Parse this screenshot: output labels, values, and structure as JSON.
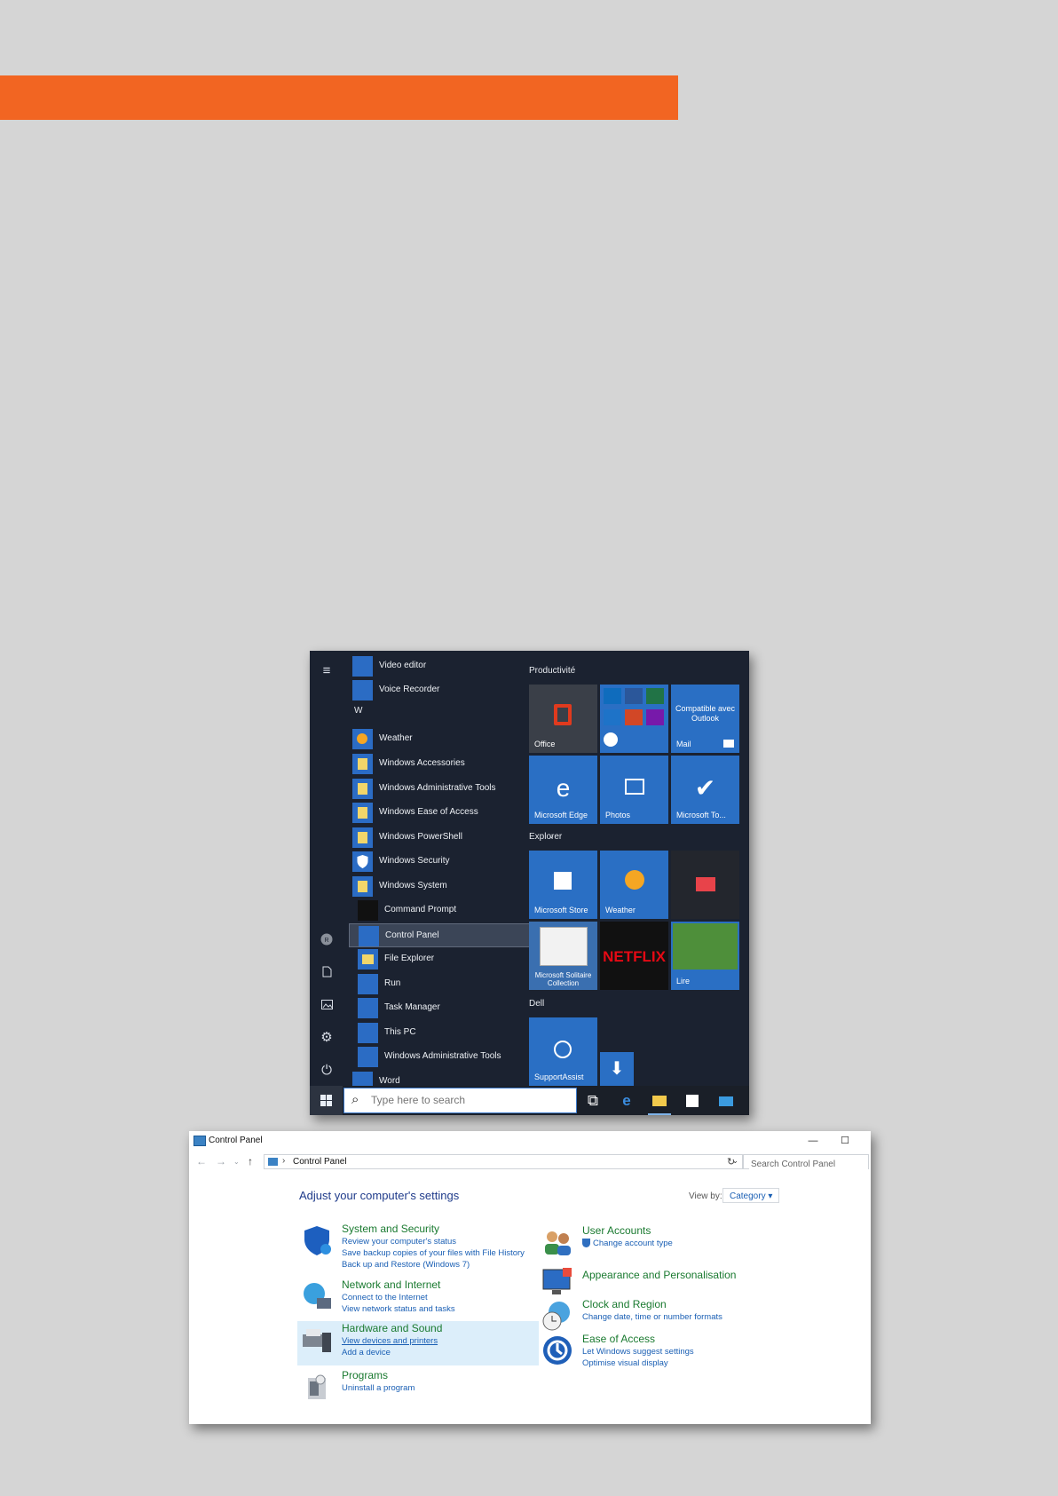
{
  "start_menu": {
    "rail": {
      "menu": "≡",
      "user": "user-icon",
      "documents": "document-icon",
      "pictures": "picture-icon",
      "settings": "gear-icon",
      "power": "power-icon"
    },
    "apps_top": [
      {
        "label": "Video editor"
      },
      {
        "label": "Voice Recorder"
      }
    ],
    "group_w": "W",
    "apps_w": [
      {
        "label": "Weather"
      },
      {
        "label": "Windows Accessories",
        "expand": "⌄"
      },
      {
        "label": "Windows Administrative Tools",
        "expand": "⌄"
      },
      {
        "label": "Windows Ease of Access",
        "expand": "⌄"
      },
      {
        "label": "Windows PowerShell",
        "expand": "⌄"
      },
      {
        "label": "Windows Security"
      },
      {
        "label": "Windows System",
        "expand": "⌃"
      }
    ],
    "apps_system": [
      {
        "label": "Command Prompt"
      },
      {
        "label": "Control Panel",
        "selected": true
      },
      {
        "label": "File Explorer"
      },
      {
        "label": "Run"
      },
      {
        "label": "Task Manager"
      },
      {
        "label": "This PC"
      },
      {
        "label": "Windows Administrative Tools"
      }
    ],
    "app_partial": "Word",
    "sections": {
      "productivity": "Productivité",
      "explorer": "Explorer",
      "dell": "Dell"
    },
    "tiles": {
      "office": "Office",
      "mail_top": "Compatible avec Outlook",
      "mail": "Mail",
      "edge": "Microsoft Edge",
      "photos": "Photos",
      "todo": "Microsoft To...",
      "store": "Microsoft Store",
      "weather": "Weather",
      "solitaire": "Microsoft Solitaire Collection",
      "netflix": "NETFLIX",
      "play": "Lire",
      "supportassist": "SupportAssist"
    },
    "taskbar": {
      "search_placeholder": "Type here to search"
    }
  },
  "control_panel": {
    "title": "Control Panel",
    "breadcrumb": "Control Panel",
    "search_placeholder": "Search Control Panel",
    "heading": "Adjust your computer's settings",
    "view_by_label": "View by:",
    "view_by_value": "Category ▾",
    "left": [
      {
        "title": "System and Security",
        "links": [
          "Review your computer's status",
          "Save backup copies of your files with File History",
          "Back up and Restore (Windows 7)"
        ]
      },
      {
        "title": "Network and Internet",
        "links": [
          "Connect to the Internet",
          "View network status and tasks"
        ]
      },
      {
        "title": "Hardware and Sound",
        "links": [
          "View devices and printers",
          "Add a device"
        ]
      },
      {
        "title": "Programs",
        "links": [
          "Uninstall a program"
        ]
      }
    ],
    "right": [
      {
        "title": "User Accounts",
        "links": [
          "Change account type"
        ]
      },
      {
        "title": "Appearance and Personalisation",
        "links": []
      },
      {
        "title": "Clock and Region",
        "links": [
          "Change date, time or number formats"
        ]
      },
      {
        "title": "Ease of Access",
        "links": [
          "Let Windows suggest settings",
          "Optimise visual display"
        ]
      }
    ]
  }
}
